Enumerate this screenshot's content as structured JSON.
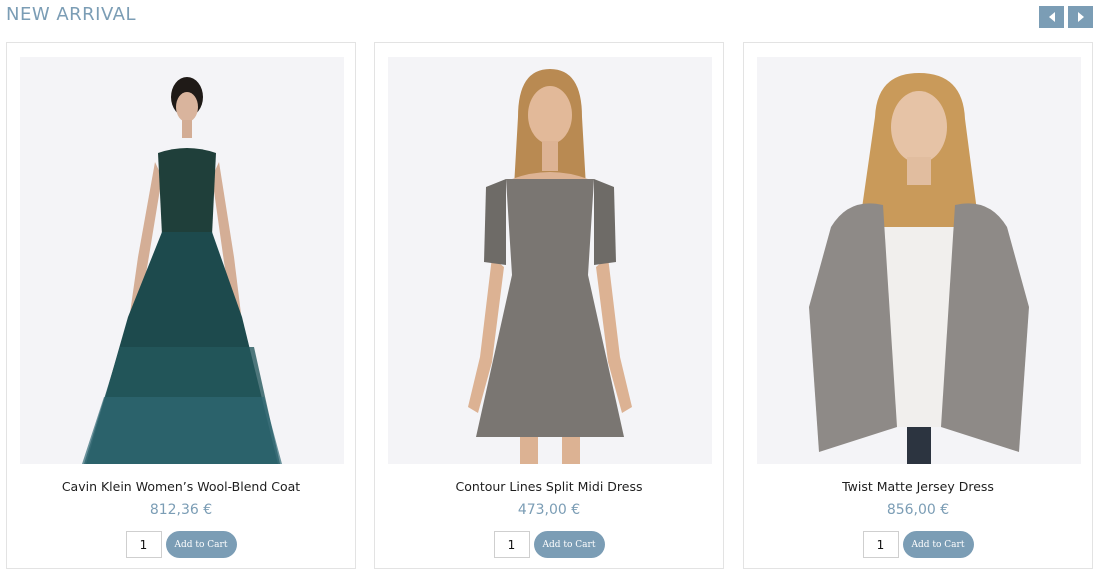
{
  "section": {
    "title": "NEW ARRIVAL",
    "prev_icon": "caret-left-icon",
    "next_icon": "caret-right-icon",
    "accent_color": "#7b9db5"
  },
  "products": [
    {
      "name": "Cavin Klein Women’s Wool-Blend Coat",
      "price": "812,36 €",
      "quantity": "1",
      "add_label": "Add to Cart",
      "image": "model-in-teal-ruffled-gown"
    },
    {
      "name": "Contour Lines Split Midi Dress",
      "price": "473,00 €",
      "quantity": "1",
      "add_label": "Add to Cart",
      "image": "model-in-printed-mini-dress"
    },
    {
      "name": "Twist Matte Jersey Dress",
      "price": "856,00 €",
      "quantity": "1",
      "add_label": "Add to Cart",
      "image": "model-in-grey-cardigan"
    }
  ]
}
